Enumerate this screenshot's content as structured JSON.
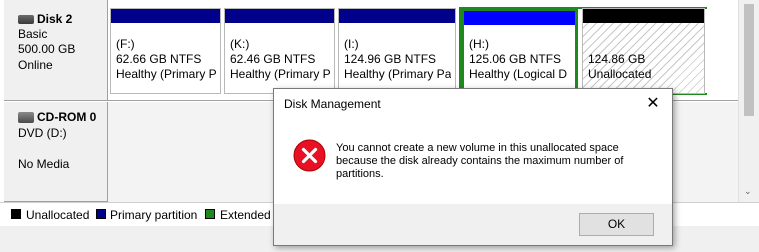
{
  "disk2": {
    "name": "Disk 2",
    "type": "Basic",
    "size": "500.00 GB",
    "status": "Online",
    "partitions": [
      {
        "letter": "(F:)",
        "size": "62.66 GB NTFS",
        "health": "Healthy (Primary P",
        "kind": "primary"
      },
      {
        "letter": "(K:)",
        "size": "62.46 GB NTFS",
        "health": "Healthy (Primary P",
        "kind": "primary"
      },
      {
        "letter": "(I:)",
        "size": "124.96 GB NTFS",
        "health": "Healthy (Primary Pa",
        "kind": "primary"
      },
      {
        "letter": "(H:)",
        "size": "125.06 GB NTFS",
        "health": "Healthy (Logical D",
        "kind": "logical"
      },
      {
        "letter": "",
        "size": "124.86 GB",
        "health": "Unallocated",
        "kind": "unallocated"
      }
    ]
  },
  "cdrom0": {
    "name": "CD-ROM 0",
    "drive": "DVD (D:)",
    "status": "No Media"
  },
  "legend": {
    "items": [
      {
        "label": "Unallocated",
        "color": "#000000"
      },
      {
        "label": "Primary partition",
        "color": "#00008b"
      },
      {
        "label": "Extended",
        "color": "#1e8a1e"
      }
    ]
  },
  "colors": {
    "primary_bar": "#00008b",
    "logical_bar": "#0000ff",
    "unallocated_bar": "#000000",
    "extended_border": "#1e8a1e",
    "error_red": "#e81123"
  },
  "dialog": {
    "title": "Disk Management",
    "close_glyph": "✕",
    "icon": "error-icon",
    "message_line1": "You cannot create a new volume in this unallocated space",
    "message_line2": "because the disk already contains the maximum number of",
    "message_line3": "partitions.",
    "ok_label": "OK"
  }
}
